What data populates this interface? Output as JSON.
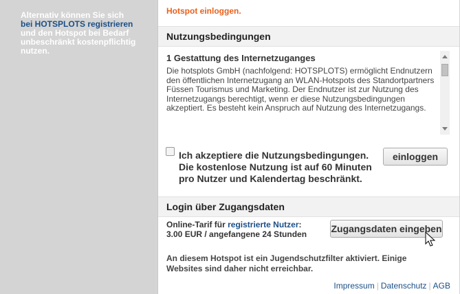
{
  "sidebar": {
    "text_before": "Alternativ können Sie sich",
    "link": "bei HOTSPLOTS registrieren",
    "text_after": "und den Hotspot bei Bedarf unbeschränkt kostenpflichtig nutzen."
  },
  "main": {
    "hotspot_login_text": "Hotspot einloggen.",
    "terms_heading": "Nutzungsbedingungen",
    "terms_title": "1 Gestattung des Internetzuganges",
    "terms_body": "Die hotsplots GmbH (nachfolgend: HOTSPLOTS) ermöglicht Endnutzern den öffentlichen Internetzugang an WLAN-Hotspots des Standortpartners Füssen Tourismus und Marketing. Der Endnutzer ist zur Nutzung des Internetzugangs berechtigt, wenn er diese Nutzungsbedingungen akzeptiert. Es besteht kein Anspruch auf Nutzung des Internetzugangs.",
    "accept_label": "Ich akzeptiere die Nutzungsbedingungen. Die kostenlose Nutzung ist auf 60 Minuten pro Nutzer und Kalendertag beschränkt.",
    "accept_checked": false,
    "login_button": "einloggen",
    "login_heading": "Login über Zugangsdaten",
    "tarif_prefix": "Online-Tarif für",
    "tarif_link": "registrierte Nutzer",
    "tarif_suffix": ":",
    "tarif_price": "3.00 EUR / angefangene 24 Stunden",
    "credentials_button": "Zugangsdaten eingeben",
    "jugend_notice": "An diesem Hotspot ist ein Jugendschutzfilter aktiviert. Einige Websites sind daher nicht erreichbar."
  },
  "footer": {
    "impressum": "Impressum",
    "datenschutz": "Datenschutz",
    "agb": "AGB"
  },
  "colors": {
    "accent_orange": "#e8611a",
    "link_blue": "#1b4f86",
    "background_gray": "#d4d4d4"
  }
}
